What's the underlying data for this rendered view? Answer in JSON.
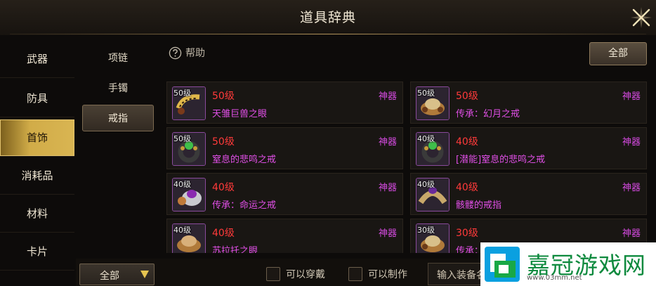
{
  "window": {
    "title": "道具辞典"
  },
  "categories": [
    {
      "label": "武器"
    },
    {
      "label": "防具"
    },
    {
      "label": "首饰"
    },
    {
      "label": "消耗品"
    },
    {
      "label": "材料"
    },
    {
      "label": "卡片"
    }
  ],
  "active_category": "首饰",
  "subcategories": [
    {
      "label": "项链"
    },
    {
      "label": "手镯"
    },
    {
      "label": "戒指"
    }
  ],
  "active_subcategory": "戒指",
  "help": {
    "label": "帮助"
  },
  "top_filter": {
    "label": "全部"
  },
  "items": [
    {
      "level_badge": "50级",
      "level": "50级",
      "name": "天雏巨兽之眼",
      "tier": "神器"
    },
    {
      "level_badge": "50级",
      "level": "50级",
      "name": "传承：幻月之戒",
      "tier": "神器"
    },
    {
      "level_badge": "50级",
      "level": "50级",
      "name": "窒息的悲鸣之戒",
      "tier": "神器"
    },
    {
      "level_badge": "40级",
      "level": "40级",
      "name": "[潜能]窒息的悲鸣之戒",
      "tier": "神器"
    },
    {
      "level_badge": "40级",
      "level": "40级",
      "name": "传承：命运之戒",
      "tier": "神器"
    },
    {
      "level_badge": "40级",
      "level": "40级",
      "name": "骸髅的戒指",
      "tier": "神器"
    },
    {
      "level_badge": "40级",
      "level": "40级",
      "name": "苏拉托之眼",
      "tier": "神器"
    },
    {
      "level_badge": "30级",
      "level": "30级",
      "name": "传承：",
      "tier": "神器"
    }
  ],
  "bottom": {
    "dropdown_value": "全部",
    "checkbox_wearable": "可以穿戴",
    "checkbox_craftable": "可以制作",
    "search_placeholder": "输入装备名"
  },
  "watermark": {
    "text": "嘉冠游戏网",
    "url": "www.03mm.net"
  },
  "colors": {
    "accent_gold": "#d1ac48",
    "item_level": "#ff3a3a",
    "item_name": "#e04fe6",
    "tier": "#d44adf"
  }
}
